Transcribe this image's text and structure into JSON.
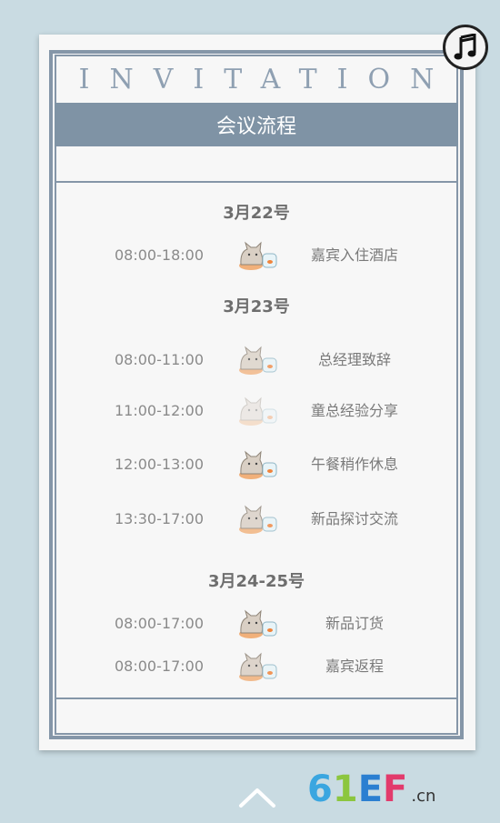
{
  "card": {
    "title": "INVITATION",
    "header": "会议流程"
  },
  "schedule": [
    {
      "date": "3月22号",
      "items": [
        {
          "time": "08:00-18:00",
          "event": "嘉宾入住酒店",
          "opacity": 1.0
        }
      ]
    },
    {
      "date": "3月23号",
      "items": [
        {
          "time": "08:00-11:00",
          "event": "总经理致辞",
          "opacity": 0.75
        },
        {
          "time": "11:00-12:00",
          "event": "童总经验分享",
          "opacity": 0.35
        },
        {
          "time": "12:00-13:00",
          "event": "午餐稍作休息",
          "opacity": 1.0
        },
        {
          "time": "13:30-17:00",
          "event": "新品探讨交流",
          "opacity": 0.8
        }
      ]
    },
    {
      "date": "3月24-25号",
      "items": [
        {
          "time": "08:00-17:00",
          "event": "新品订货",
          "opacity": 1.0
        },
        {
          "time": "08:00-17:00",
          "event": "嘉宾返程",
          "opacity": 0.85
        }
      ]
    }
  ],
  "music_icon": "music-note-icon",
  "nav_icon": "chevron-up-icon",
  "logo": {
    "text": "61EF",
    "suffix": ".cn",
    "colors": [
      "#3aa6e0",
      "#8cc63f",
      "#2b7fd1",
      "#e23b6c"
    ]
  }
}
